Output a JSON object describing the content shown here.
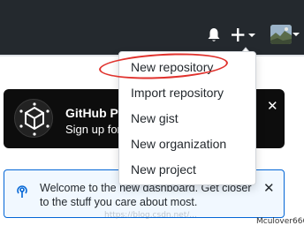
{
  "header": {
    "bell_icon": "bell-icon",
    "plus_icon": "plus-icon",
    "avatar_icon": "user-avatar"
  },
  "dropdown": {
    "items": [
      {
        "label": "New repository"
      },
      {
        "label": "Import repository"
      },
      {
        "label": "New gist"
      },
      {
        "label": "New organization"
      },
      {
        "label": "New project"
      }
    ],
    "highlight_color": "#e0322d"
  },
  "promo": {
    "title": "GitHub P",
    "subtitle": "Sign up for",
    "close_label": "✕"
  },
  "notice": {
    "text": "Welcome to the new dashboard. Get closer to the stuff you care about most.",
    "close_label": "✕",
    "accent": "#0366d6"
  },
  "watermark": {
    "text": "https://blog.csdn.net/...",
    "user": "Mculover666"
  },
  "colors": {
    "header_bg": "#24292e",
    "promo_bg": "#0d0d0d"
  }
}
